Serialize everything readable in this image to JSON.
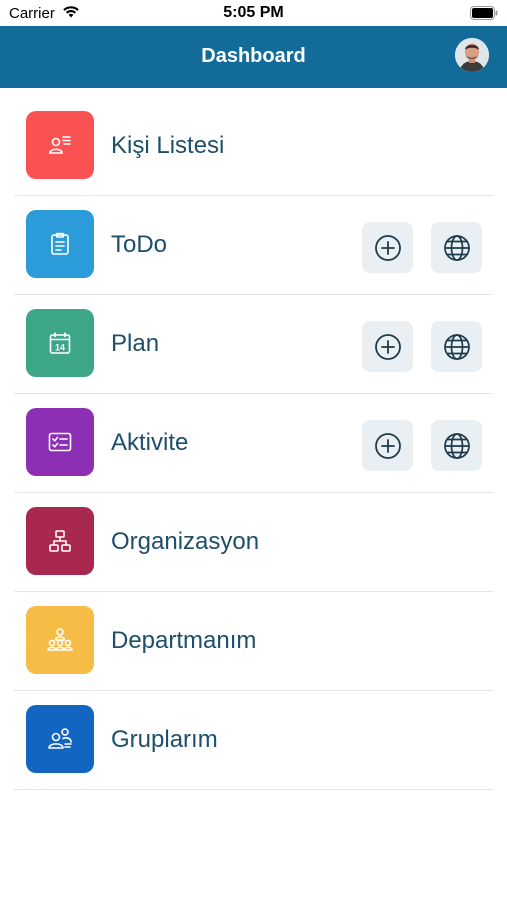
{
  "status_bar": {
    "carrier": "Carrier",
    "time": "5:05 PM"
  },
  "nav": {
    "title": "Dashboard"
  },
  "colors": {
    "nav_background": "#136b9a",
    "label_text": "#1d4e6b",
    "action_button_bg": "#e9eff2"
  },
  "items": [
    {
      "label": "Kişi Listesi",
      "color": "#fa5152",
      "icon": "contact-list-icon",
      "actions": false
    },
    {
      "label": "ToDo",
      "color": "#2b9bd9",
      "icon": "clipboard-icon",
      "actions": true
    },
    {
      "label": "Plan",
      "color": "#3da689",
      "icon": "calendar-icon",
      "calendar_day": "14",
      "actions": true
    },
    {
      "label": "Aktivite",
      "color": "#8d2fb5",
      "icon": "checklist-icon",
      "actions": true
    },
    {
      "label": "Organizasyon",
      "color": "#a82850",
      "icon": "org-chart-icon",
      "actions": false
    },
    {
      "label": "Departmanım",
      "color": "#f7bc45",
      "icon": "department-icon",
      "actions": false
    },
    {
      "label": "Gruplarım",
      "color": "#1266c2",
      "icon": "group-icon",
      "actions": false
    }
  ],
  "action_icons": {
    "add": "plus-circle-icon",
    "web": "globe-icon"
  }
}
